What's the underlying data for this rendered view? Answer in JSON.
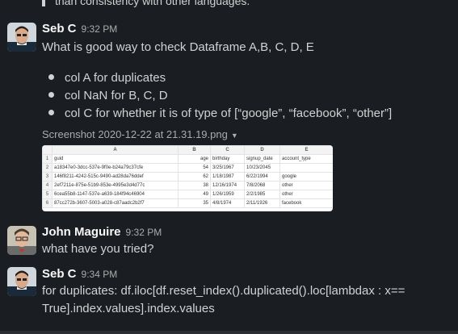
{
  "prev_quote_text": "than consistency with other languages.",
  "messages": [
    {
      "author": "Seb C",
      "time": "9:32 PM",
      "text": "What is good way to check Dataframe A,B, C, D, E",
      "bullets": [
        "col A for duplicates",
        "col NaN for B, C, D",
        "col C for whether it is of type of [“google”, “facebook”, “other”]"
      ],
      "attachment": {
        "file_name": "Screenshot 2020-12-22 at 21.31.19.png",
        "sheet": {
          "col_letters": [
            "A",
            "B",
            "C",
            "D",
            "E"
          ],
          "rows": [
            [
              "1",
              "guid",
              "age",
              "birthday",
              "signup_date",
              "account_type"
            ],
            [
              "2",
              "a18347e0-3dcc-537e-9f0e-b24a79c37cfe",
              "54",
              "3/25/1967",
              "10/23/2045",
              ""
            ],
            [
              "3",
              "146f8211-4242-515c-9490-ad28da76ddef",
              "62",
              "1/18/1987",
              "6/22/1994",
              "google"
            ],
            [
              "4",
              "2ef7211e-875e-51b9-853e-4995e3d4d77c",
              "38",
              "12/16/1974",
              "7/8/2068",
              "other"
            ],
            [
              "5",
              "6cea55b8-1147-537e-a639-184f94c46904",
              "49",
              "1/26/1959",
              "2/2/1985",
              "other"
            ],
            [
              "6",
              "87cc272b-3607-5003-a028-c87aadc2b2f7",
              "35",
              "4/8/1974",
              "2/11/1926",
              "facebook"
            ]
          ]
        }
      }
    },
    {
      "author": "John Maguire",
      "time": "9:32 PM",
      "text": "what have you tried?"
    },
    {
      "author": "Seb C",
      "time": "9:34 PM",
      "text_line1": "for duplicates: df.iloc[df.reset_index().duplicated().loc[lambdax : x==",
      "text_line2": "True].index.values].index.values"
    }
  ],
  "colors": {
    "background": "#1a1d21",
    "text": "#d1d2d3",
    "name": "#f8f8f8",
    "muted": "#ababad"
  }
}
